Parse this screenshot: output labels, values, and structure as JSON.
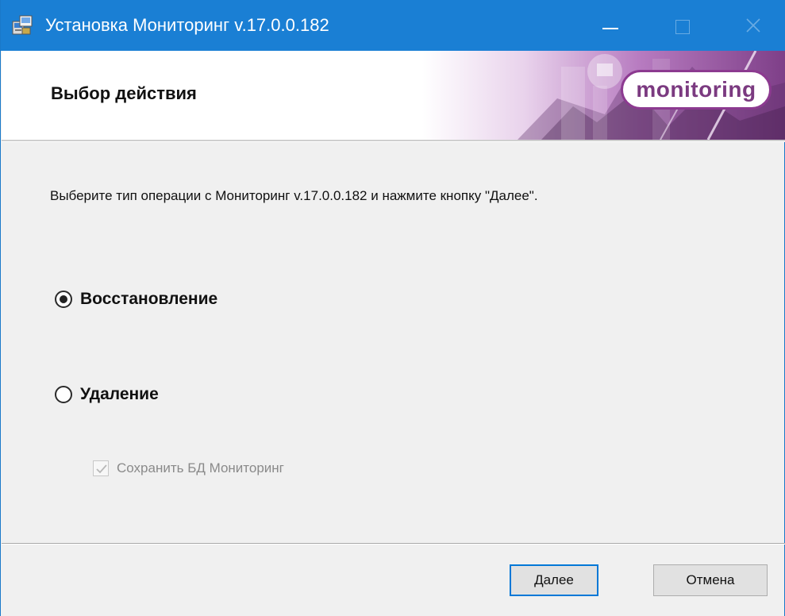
{
  "window": {
    "title": "Установка Мониторинг v.17.0.0.182"
  },
  "header": {
    "title": "Выбор действия",
    "logo_text": "monitoring"
  },
  "main": {
    "instruction": "Выберите тип операции с Мониторинг v.17.0.0.182 и нажмите кнопку \"Далее\".",
    "options": [
      {
        "label": "Восстановление",
        "selected": true
      },
      {
        "label": "Удаление",
        "selected": false
      }
    ],
    "checkbox": {
      "label": "Сохранить БД Мониторинг",
      "checked": true,
      "enabled": false
    }
  },
  "footer": {
    "next_label": "Далее",
    "cancel_label": "Отмена"
  },
  "colors": {
    "titlebar": "#1a7fd4",
    "accent_purple": "#8c3a90",
    "focus_border": "#0078d7"
  },
  "icons": {
    "app": "installer-icon",
    "minimize": "minimize-icon",
    "maximize": "maximize-icon",
    "close": "close-icon"
  }
}
